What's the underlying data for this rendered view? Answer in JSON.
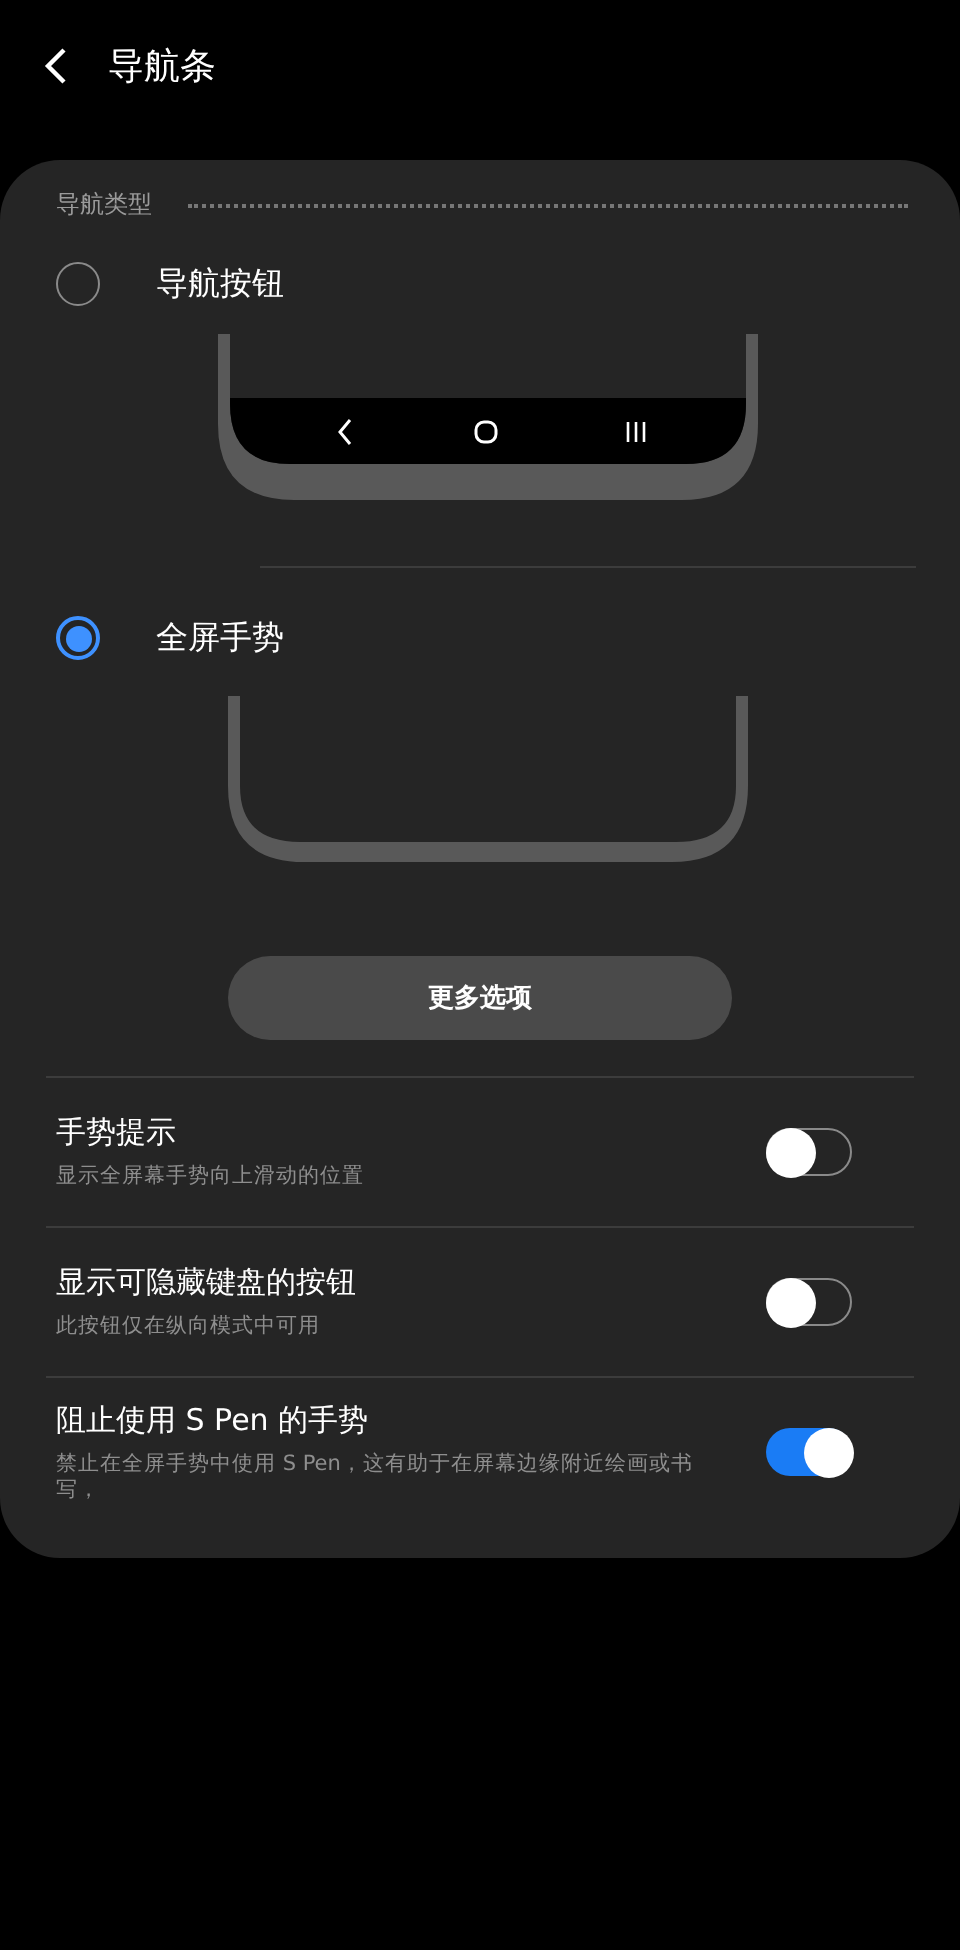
{
  "header": {
    "title": "导航条"
  },
  "section": {
    "title": "导航类型"
  },
  "nav_options": [
    {
      "label": "导航按钮",
      "selected": false,
      "kind": "buttons"
    },
    {
      "label": "全屏手势",
      "selected": true,
      "kind": "gestures"
    }
  ],
  "more_button": "更多选项",
  "settings": [
    {
      "title": "手势提示",
      "subtitle": "显示全屏幕手势向上滑动的位置",
      "on": false
    },
    {
      "title": "显示可隐藏键盘的按钮",
      "subtitle": "此按钮仅在纵向模式中可用",
      "on": false
    },
    {
      "title": "阻止使用 S Pen 的手势",
      "subtitle": "禁止在全屏手势中使用 S Pen，这有助于在屏幕边缘附近绘画或书写，",
      "on": true
    }
  ]
}
